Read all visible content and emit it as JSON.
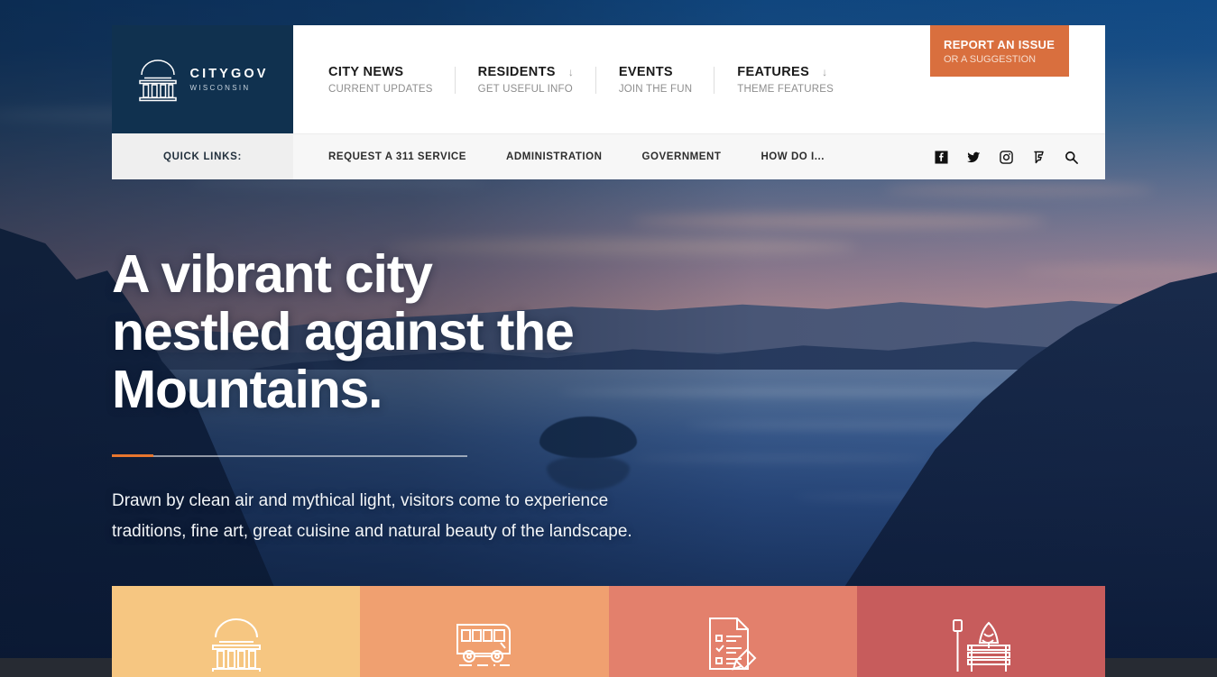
{
  "site": {
    "logo_name": "CITYGOV",
    "logo_sub": "WISCONSIN",
    "logo_icon": "government-building-icon"
  },
  "header": {
    "nav": [
      {
        "label": "CITY NEWS",
        "sublabel": "CURRENT UPDATES",
        "has_dropdown": false
      },
      {
        "label": "RESIDENTS",
        "sublabel": "GET USEFUL INFO",
        "has_dropdown": true,
        "arrow": "↓"
      },
      {
        "label": "EVENTS",
        "sublabel": "JOIN THE FUN",
        "has_dropdown": false
      },
      {
        "label": "FEATURES",
        "sublabel": "THEME FEATURES",
        "has_dropdown": true,
        "arrow": "↓"
      }
    ],
    "cta": {
      "main": "REPORT AN ISSUE",
      "sub": "OR A SUGGESTION",
      "color": "#d96f3e"
    }
  },
  "quickbar": {
    "label": "QUICK LINKS:",
    "links": [
      "REQUEST A 311 SERVICE",
      "ADMINISTRATION",
      "GOVERNMENT",
      "HOW DO I..."
    ],
    "socials": [
      "facebook-icon",
      "twitter-icon",
      "instagram-icon",
      "foursquare-icon",
      "search-icon"
    ]
  },
  "hero": {
    "heading_line1": "A vibrant city",
    "heading_line2": "nestled against the",
    "heading_line3": "Mountains.",
    "body": "Drawn by clean air and mythical light, visitors come to experience traditions, fine art, great cuisine and natural beauty of the landscape.",
    "divider_accent_color": "#e8762e"
  },
  "cards": [
    {
      "icon": "government-building-icon",
      "color": "#f6c681"
    },
    {
      "icon": "bus-icon",
      "color": "#f0a070"
    },
    {
      "icon": "form-checklist-pencil-icon",
      "color": "#e3806c"
    },
    {
      "icon": "park-bench-icon",
      "color": "#c75c5c"
    }
  ]
}
